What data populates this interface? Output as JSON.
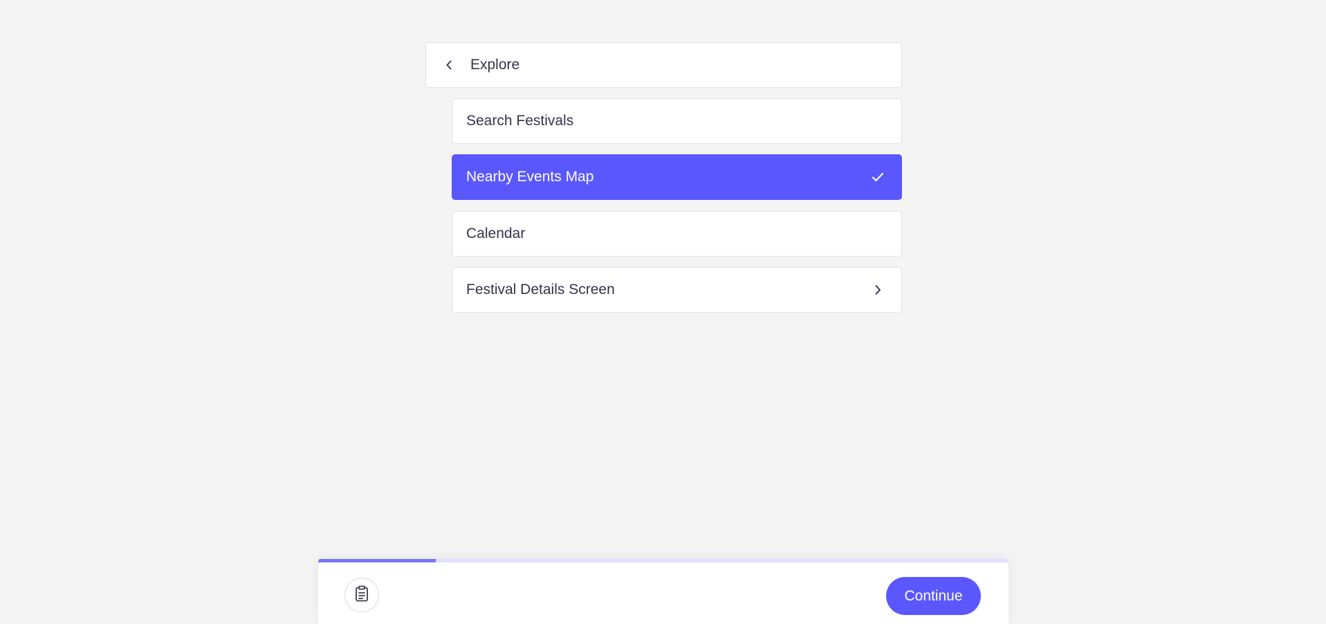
{
  "colors": {
    "accent": "#5b57ff",
    "background": "#f4f4f4",
    "card": "#ffffff",
    "progress_fill": "#7b76f4",
    "progress_track": "#e2e0ff"
  },
  "header": {
    "back_icon": "chevron-left-icon",
    "title": "Explore"
  },
  "menu": {
    "items": [
      {
        "label": "Search Festivals",
        "selected": false,
        "trailing_icon": ""
      },
      {
        "label": "Nearby Events Map",
        "selected": true,
        "trailing_icon": "check-icon"
      },
      {
        "label": "Calendar",
        "selected": false,
        "trailing_icon": ""
      },
      {
        "label": "Festival Details Screen",
        "selected": false,
        "trailing_icon": "chevron-right-icon"
      }
    ]
  },
  "footer": {
    "progress_fraction": 0.17,
    "notes_icon": "clipboard-icon",
    "continue_label": "Continue"
  }
}
